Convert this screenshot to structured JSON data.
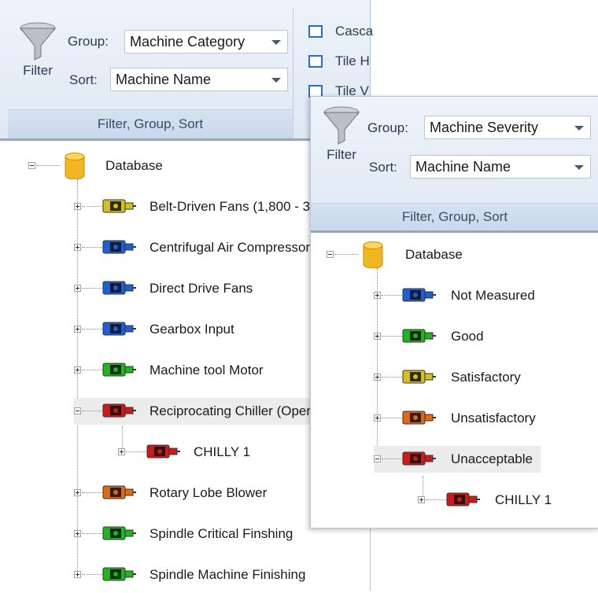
{
  "left": {
    "ribbon": {
      "filter_label": "Filter",
      "group_label": "Group:",
      "group_value": "Machine Category",
      "sort_label": "Sort:",
      "sort_value": "Machine Name",
      "section_label": "Filter, Group, Sort",
      "window_cmds": [
        "Casca",
        "Tile H",
        "Tile V"
      ]
    },
    "tree": {
      "root": "Database",
      "items": [
        {
          "label": "Belt-Driven Fans (1,800 - 3",
          "color": "#d4c21a",
          "expanded": false
        },
        {
          "label": "Centrifugal Air Compressor",
          "color": "#1f5fd6",
          "expanded": false
        },
        {
          "label": "Direct Drive Fans",
          "color": "#1f5fd6",
          "expanded": false
        },
        {
          "label": "Gearbox Input",
          "color": "#1f5fd6",
          "expanded": false
        },
        {
          "label": "Machine tool Motor",
          "color": "#1fb51f",
          "expanded": false
        },
        {
          "label": "Reciprocating Chiller (Oper",
          "color": "#cc1a1a",
          "expanded": true
        },
        {
          "label": "Rotary Lobe Blower",
          "color": "#e06a10",
          "expanded": false
        },
        {
          "label": "Spindle Critical Finshing",
          "color": "#1fb51f",
          "expanded": false
        },
        {
          "label": "Spindle Machine Finishing",
          "color": "#1fb51f",
          "expanded": false
        }
      ],
      "child": {
        "label": "CHILLY 1",
        "color": "#cc1a1a"
      }
    }
  },
  "right": {
    "ribbon": {
      "filter_label": "Filter",
      "group_label": "Group:",
      "group_value": "Machine Severity",
      "sort_label": "Sort:",
      "sort_value": "Machine Name",
      "section_label": "Filter, Group, Sort"
    },
    "tree": {
      "root": "Database",
      "items": [
        {
          "label": "Not Measured",
          "color": "#1f5fd6"
        },
        {
          "label": "Good",
          "color": "#1fb51f"
        },
        {
          "label": "Satisfactory",
          "color": "#d4c21a"
        },
        {
          "label": "Unsatisfactory",
          "color": "#e06a10"
        },
        {
          "label": "Unacceptable",
          "color": "#cc1a1a"
        }
      ],
      "child": {
        "label": "CHILLY 1",
        "color": "#cc1a1a"
      }
    }
  }
}
